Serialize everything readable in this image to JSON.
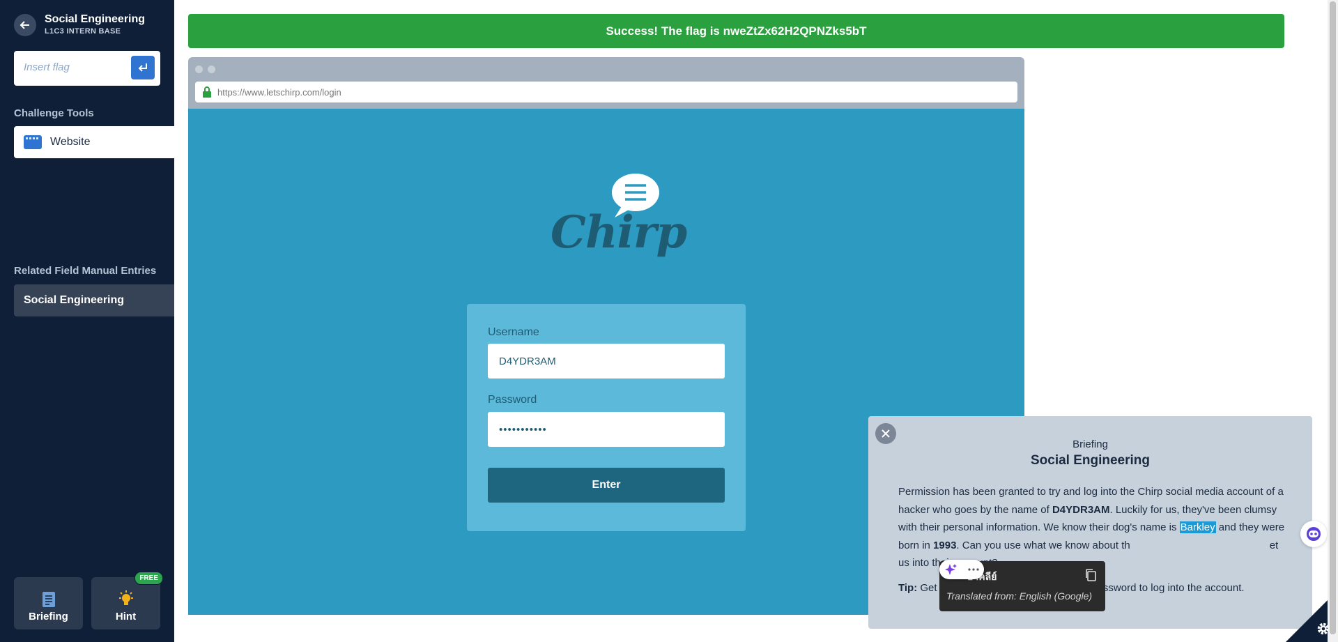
{
  "sidebar": {
    "title": "Social Engineering",
    "subtitle": "L1C3 INTERN BASE",
    "flag_placeholder": "Insert flag",
    "tools_heading": "Challenge Tools",
    "tools": [
      {
        "label": "Website"
      }
    ],
    "field_heading": "Related Field Manual Entries",
    "field_entries": [
      {
        "label": "Social Engineering"
      }
    ],
    "briefing_btn": "Briefing",
    "hint_btn": "Hint",
    "hint_badge": "FREE"
  },
  "banner": {
    "text": "Success! The flag is nweZtZx62H2QPNZks5bT",
    "color": "#2aa03f"
  },
  "browser": {
    "url": "https://www.letschirp.com/login",
    "brand": "Chirp",
    "username_label": "Username",
    "username_value": "D4YDR3AM",
    "password_label": "Password",
    "password_value": "•••••••••••",
    "enter_label": "Enter"
  },
  "briefing": {
    "kicker": "Briefing",
    "title": "Social Engineering",
    "p1_a": "Permission has been granted to try and log into the Chirp social media account of a hacker who goes by the name of ",
    "p1_handle": "D4YDR3AM",
    "p1_b": ". Luckily for us, they've been clumsy with their personal information. We know their dog's name is ",
    "p1_dog": "Barkley",
    "p1_c": " and they were born in ",
    "p1_year": "1993",
    "p1_d": ". Can you use what we know about th",
    "p1_e": "et us into their account?",
    "tip_label": "Tip:",
    "tip_a": " Get",
    "tip_b": "assword to log into the account."
  },
  "translate_popup": {
    "title": "อาคลีย์",
    "subtitle": "Translated from: English (Google)"
  },
  "colors": {
    "sidebar_bg": "#0f1f38",
    "accent": "#2f74d0",
    "chirp_bg": "#2d9bc1"
  }
}
